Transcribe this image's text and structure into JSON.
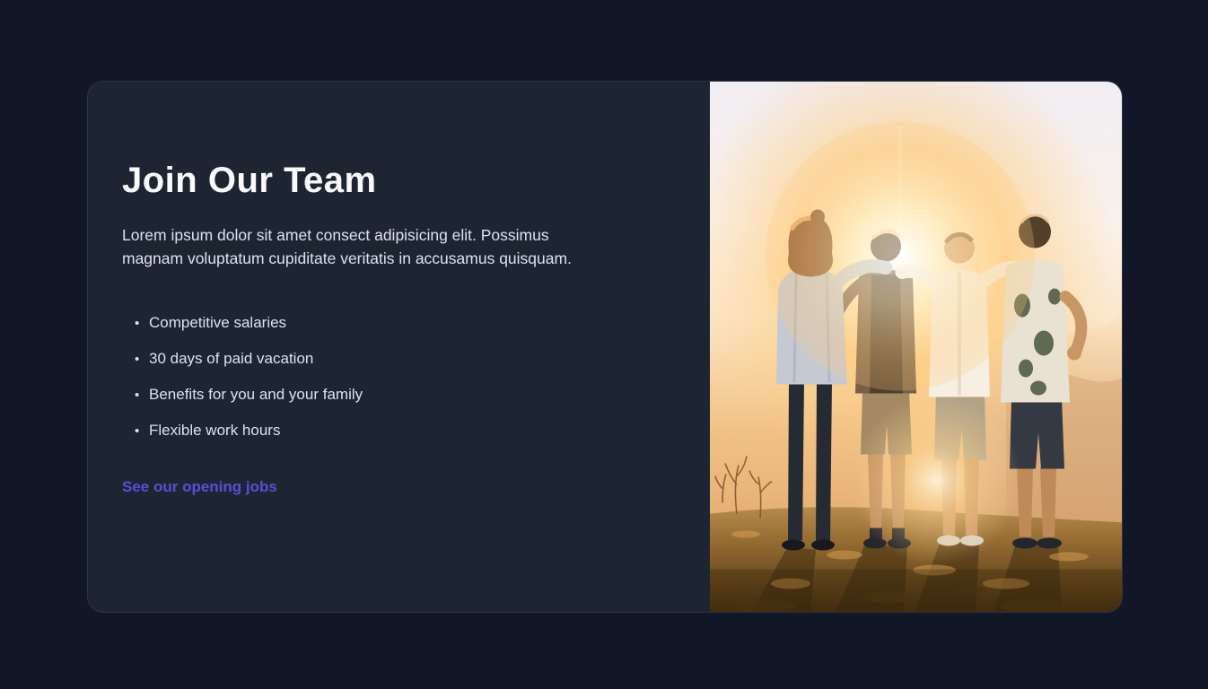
{
  "theme": {
    "page_bg": "#111726",
    "card_bg": "#1e2532",
    "card_border": "#2b3444",
    "heading_color": "#f8fafc",
    "text_color": "#dde2e8",
    "link_color": "#574fd8"
  },
  "card": {
    "title": "Join Our Team",
    "description": "Lorem ipsum dolor sit amet consect adipisicing elit. Possimus magnam voluptatum cupiditate veritatis in accusamus quisquam.",
    "bullet_glyph": "•",
    "benefits": [
      "Competitive salaries",
      "30 days of paid vacation",
      "Benefits for you and your family",
      "Flexible work hours"
    ],
    "link_label": "See our opening jobs",
    "photo_description": "Four friends standing arm in arm on a hilltop watching the sunset"
  }
}
